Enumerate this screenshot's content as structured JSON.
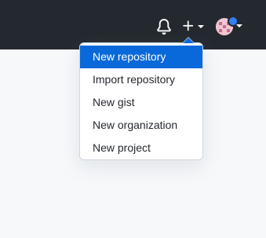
{
  "header": {
    "icons": {
      "notifications": "bell-icon",
      "create": "plus-icon",
      "profile": "avatar"
    }
  },
  "create_menu": {
    "items": [
      {
        "label": "New repository",
        "active": true
      },
      {
        "label": "Import repository",
        "active": false
      },
      {
        "label": "New gist",
        "active": false
      },
      {
        "label": "New organization",
        "active": false
      },
      {
        "label": "New project",
        "active": false
      }
    ]
  },
  "colors": {
    "header_bg": "#24292f",
    "page_bg": "#f6f8fa",
    "menu_active_bg": "#0969da",
    "notification_dot": "#2f81f7"
  }
}
